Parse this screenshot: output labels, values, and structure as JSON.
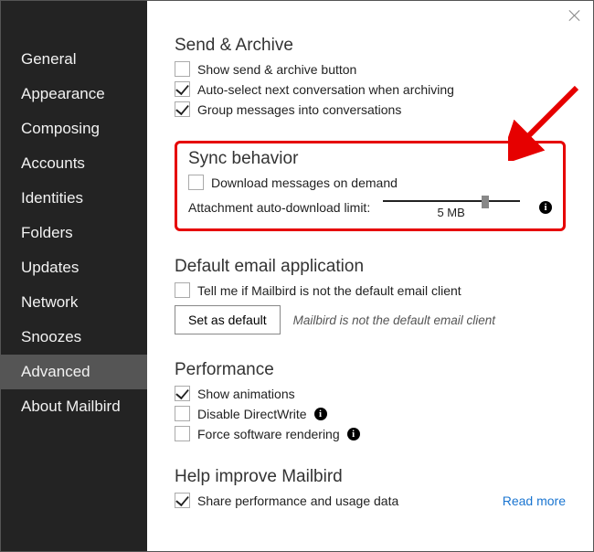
{
  "sidebar": {
    "items": [
      {
        "label": "General"
      },
      {
        "label": "Appearance"
      },
      {
        "label": "Composing"
      },
      {
        "label": "Accounts"
      },
      {
        "label": "Identities"
      },
      {
        "label": "Folders"
      },
      {
        "label": "Updates"
      },
      {
        "label": "Network"
      },
      {
        "label": "Snoozes"
      },
      {
        "label": "Advanced",
        "active": true
      },
      {
        "label": "About Mailbird"
      }
    ]
  },
  "sections": {
    "sendArchive": {
      "title": "Send & Archive",
      "items": {
        "showBtn": "Show send & archive button",
        "autoSelect": "Auto-select next conversation when archiving",
        "groupMsg": "Group messages into conversations"
      }
    },
    "sync": {
      "title": "Sync behavior",
      "downloadOnDemand": "Download messages on demand",
      "attachLimitLabel": "Attachment auto-download limit:",
      "attachLimitValue": "5 MB"
    },
    "defaultApp": {
      "title": "Default email application",
      "tellMe": "Tell me if Mailbird is not the default email client",
      "btn": "Set as default",
      "note": "Mailbird is not the default email client"
    },
    "performance": {
      "title": "Performance",
      "anim": "Show animations",
      "dwrite": "Disable DirectWrite",
      "force": "Force software rendering"
    },
    "help": {
      "title": "Help improve Mailbird",
      "share": "Share performance and usage data",
      "readMore": "Read more"
    }
  }
}
